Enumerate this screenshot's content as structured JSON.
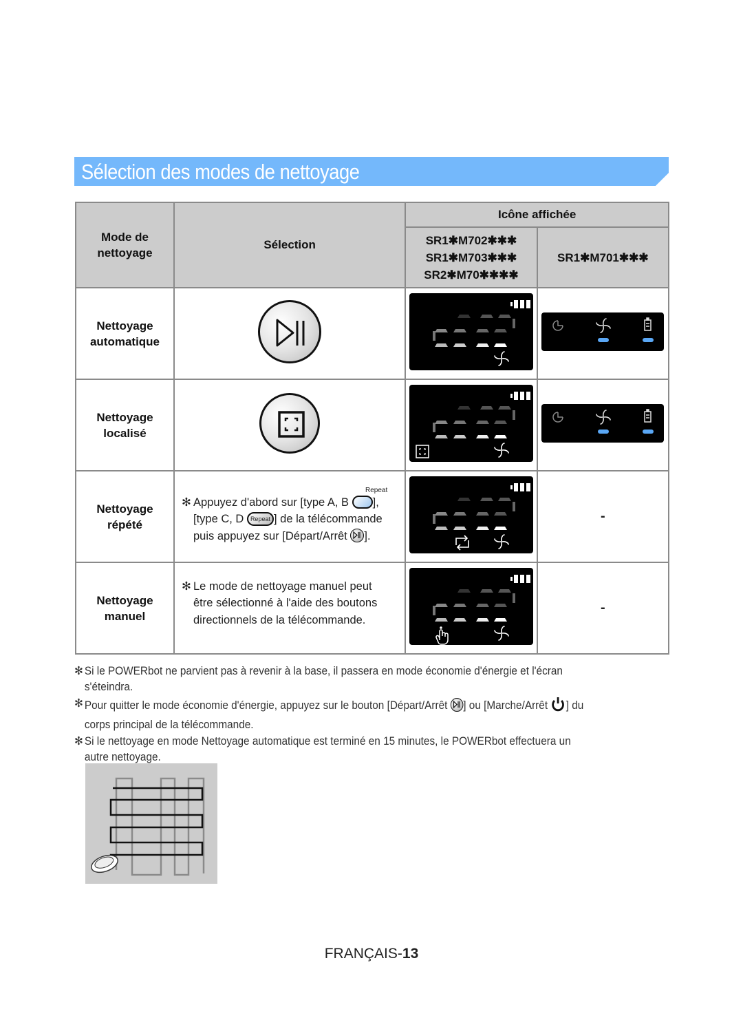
{
  "section": {
    "title": "Sélection des modes de nettoyage",
    "banner_color": "#74b8fb"
  },
  "table": {
    "headers": {
      "mode": "Mode de nettoyage",
      "mode_line1": "Mode de",
      "mode_line2": "nettoyage",
      "selection": "Sélection",
      "icon_displayed": "Icône affichée",
      "models_group1": [
        "SR1✱M702✱✱✱",
        "SR1✱M703✱✱✱",
        "SR2✱M70✱✱✱✱"
      ],
      "models_group2": "SR1✱M701✱✱✱"
    },
    "rows": [
      {
        "mode_line1": "Nettoyage",
        "mode_line2": "automatique",
        "selection_icon": "start-stop-button-icon",
        "display1_icons": [
          "battery-icon",
          "digit-display",
          "suction-fan-icon"
        ],
        "display2_icons": [
          "timer-icon",
          "suction-fan-icon",
          "battery-icon"
        ]
      },
      {
        "mode_line1": "Nettoyage",
        "mode_line2": "localisé",
        "selection_icon": "spot-clean-button-icon",
        "display1_icons": [
          "battery-icon",
          "digit-display",
          "spot-clean-icon",
          "suction-fan-icon"
        ],
        "display2_icons": [
          "timer-icon",
          "suction-fan-icon",
          "battery-icon"
        ]
      },
      {
        "mode_line1": "Nettoyage",
        "mode_line2": "répété",
        "selection_text": {
          "repeat_label": "Repeat",
          "line1_prefix": "Appuyez d'abord sur [type A, B",
          "line1_suffix": "],",
          "line2_prefix": "[type C, D",
          "line2_button": "Repeat",
          "line2_suffix": "] de la télécommande",
          "line3_prefix": "puis appuyez sur [Départ/Arrêt",
          "line3_suffix": "]."
        },
        "display1_icons": [
          "battery-icon",
          "digit-display",
          "repeat-icon",
          "suction-fan-icon"
        ],
        "display2": "-"
      },
      {
        "mode_line1": "Nettoyage",
        "mode_line2": "manuel",
        "selection_text": {
          "line1": "Le mode de nettoyage manuel peut",
          "line2": "être sélectionné à l'aide des boutons",
          "line3": "directionnels de la télécommande."
        },
        "display1_icons": [
          "battery-icon",
          "digit-display",
          "manual-hand-icon",
          "suction-fan-icon"
        ],
        "display2": "-"
      }
    ]
  },
  "notes": {
    "asterisk": "✻",
    "note1_line1": "Si le POWERbot ne parvient pas à revenir à la base, il passera en mode économie d'énergie et l'écran",
    "note1_line2": "s'éteindra.",
    "note2_prefix": "Pour quitter le mode économie d'énergie, appuyez sur le bouton [Départ/Arrêt",
    "note2_middle": "] ou [Marche/Arrêt",
    "note2_suffix": "] du",
    "note2_line2": "corps principal de la télécommande.",
    "note3_line1": "Si le nettoyage en mode Nettoyage automatique est terminé en 15 minutes, le POWERbot effectuera un",
    "note3_line2": "autre nettoyage."
  },
  "diagram": {
    "description": "zigzag-cleaning-path-diagram"
  },
  "footer": {
    "language": "FRANÇAIS-",
    "page": "13"
  }
}
